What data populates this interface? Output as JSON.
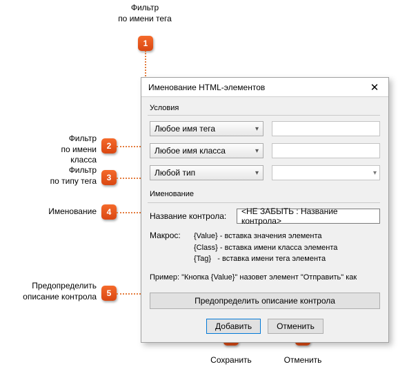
{
  "annotations": {
    "a1": "Фильтр\nпо имени тега",
    "a2": "Фильтр\nпо имени класса",
    "a3": "Фильтр\nпо типу тега",
    "a4": "Именование",
    "a5": "Предопределить\nописание контрола",
    "a6": "Сохранить",
    "a7": "Отменить"
  },
  "dialog": {
    "title": "Именование HTML-элементов",
    "section_conditions": "Условия",
    "section_naming": "Именование",
    "dropdown_tag": "Любое имя тега",
    "dropdown_class": "Любое имя класса",
    "dropdown_type": "Любой тип",
    "label_control_name": "Название контрола:",
    "value_control_name": "<НЕ ЗАБЫТЬ : Название контрола>",
    "label_macro": "Макрос:",
    "macro_lines": "{Value} - вставка значения элемента\n{Class} - вставка имени класса элемента\n{Tag}   - вставка имени тега элемента",
    "example": "Пример:   \"Кнопка {Value}\" назовет элемент \"Отправить\" как",
    "predefine_btn": "Предопределить описание контрола",
    "add_btn": "Добавить",
    "cancel_btn": "Отменить"
  }
}
